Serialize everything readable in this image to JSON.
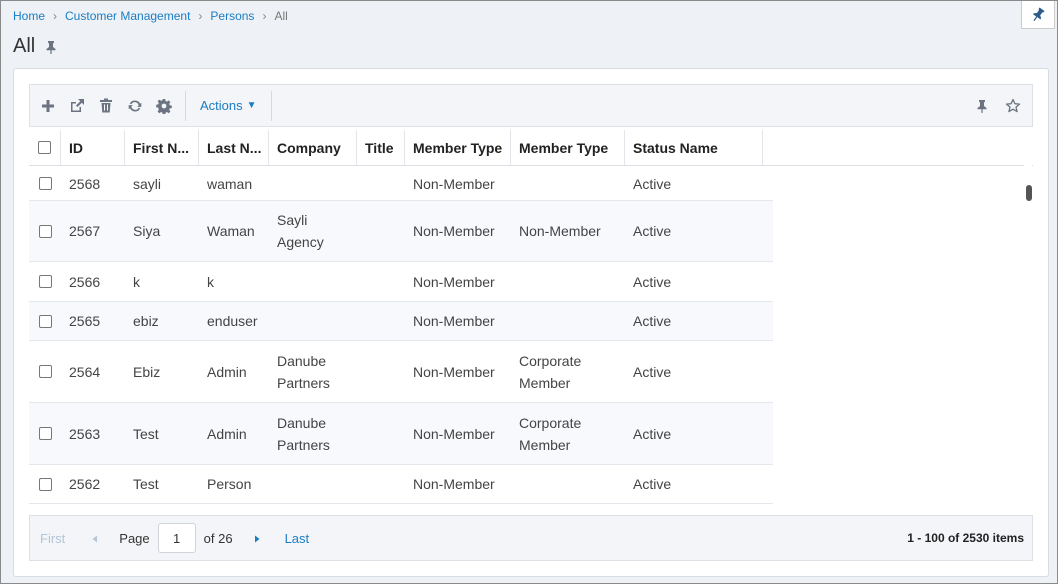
{
  "breadcrumb": {
    "home": "Home",
    "customer_management": "Customer Management",
    "persons": "Persons",
    "current": "All"
  },
  "page": {
    "title": "All"
  },
  "toolbar": {
    "actions_label": "Actions"
  },
  "grid": {
    "columns": [
      "ID",
      "First N...",
      "Last N...",
      "Company",
      "Title",
      "Member Type",
      "Member Type",
      "Status Name"
    ],
    "rows": [
      {
        "id": "2568",
        "first": "sayli",
        "last": "waman",
        "company": "",
        "title": "",
        "member_type_1": "Non-Member",
        "member_type_2": "",
        "status": "Active"
      },
      {
        "id": "2567",
        "first": "Siya",
        "last": "Waman",
        "company_l1": "Sayli",
        "company_l2": "Agency",
        "title": "",
        "member_type_1": "Non-Member",
        "member_type_2": "Non-Member",
        "status": "Active"
      },
      {
        "id": "2566",
        "first": "k",
        "last": "k",
        "company": "",
        "title": "",
        "member_type_1": "Non-Member",
        "member_type_2": "",
        "status": "Active"
      },
      {
        "id": "2565",
        "first": "ebiz",
        "last": "enduser",
        "company": "",
        "title": "",
        "member_type_1": "Non-Member",
        "member_type_2": "",
        "status": "Active"
      },
      {
        "id": "2564",
        "first": "Ebiz",
        "last": "Admin",
        "company_l1": "Danube",
        "company_l2": "Partners",
        "title": "",
        "member_type_1": "Non-Member",
        "member_type_2_l1": "Corporate",
        "member_type_2_l2": "Member",
        "status": "Active"
      },
      {
        "id": "2563",
        "first": "Test",
        "last": "Admin",
        "company_l1": "Danube",
        "company_l2": "Partners",
        "title": "",
        "member_type_1": "Non-Member",
        "member_type_2_l1": "Corporate",
        "member_type_2_l2": "Member",
        "status": "Active"
      },
      {
        "id": "2562",
        "first": "Test",
        "last": "Person",
        "company": "",
        "title": "",
        "member_type_1": "Non-Member",
        "member_type_2": "",
        "status": "Active"
      }
    ]
  },
  "pager": {
    "first": "First",
    "page_label": "Page",
    "page_value": "1",
    "of_label": "of 26",
    "last": "Last",
    "info": "1 - 100 of 2530 items"
  },
  "colors": {
    "link": "#1a7dc4",
    "icon": "#6b7480",
    "background": "#eef1f5"
  }
}
